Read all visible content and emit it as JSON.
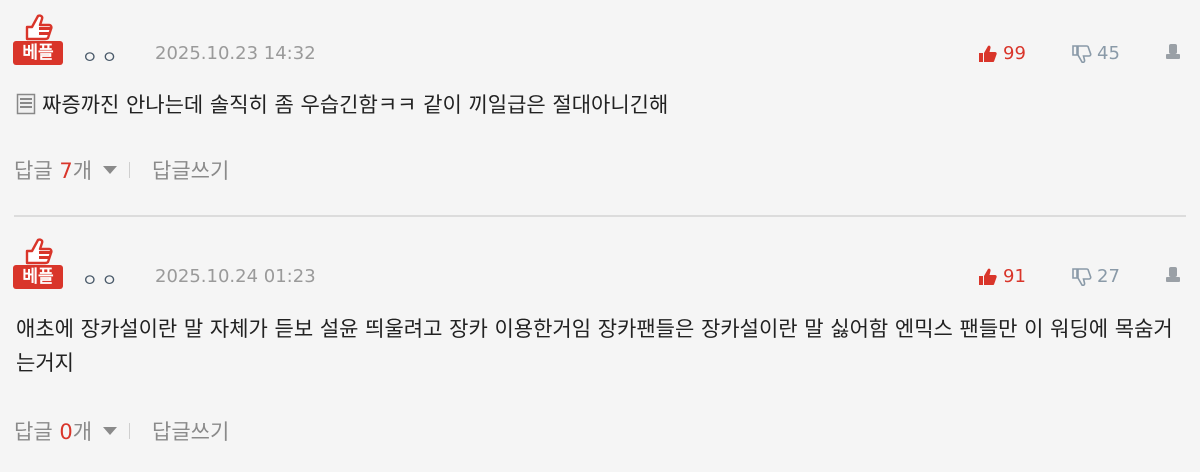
{
  "colors": {
    "accent": "#d9352a",
    "muted": "#9a9a9a",
    "background": "#f5f5f5"
  },
  "comments": [
    {
      "badge": "베플",
      "author": "ㅇㅇ",
      "date": "2025.10.23 14:32",
      "upvotes": "99",
      "downvotes": "45",
      "text": "짜증까진 안나는데 솔직히 좀 우습긴함ㅋㅋ 같이 끼일급은 절대아니긴해",
      "reply_label": "답글",
      "reply_count": "7",
      "reply_unit": "개",
      "write_reply": "답글쓰기"
    },
    {
      "badge": "베플",
      "author": "ㅇㅇ",
      "date": "2025.10.24 01:23",
      "upvotes": "91",
      "downvotes": "27",
      "text": "애초에 장카설이란 말 자체가 듣보 설윤 띄울려고 장카 이용한거임 장카팬들은 장카설이란 말 싫어함 엔믹스 팬들만 이 워딩에 목숨거는거지",
      "reply_label": "답글",
      "reply_count": "0",
      "reply_unit": "개",
      "write_reply": "답글쓰기"
    }
  ]
}
